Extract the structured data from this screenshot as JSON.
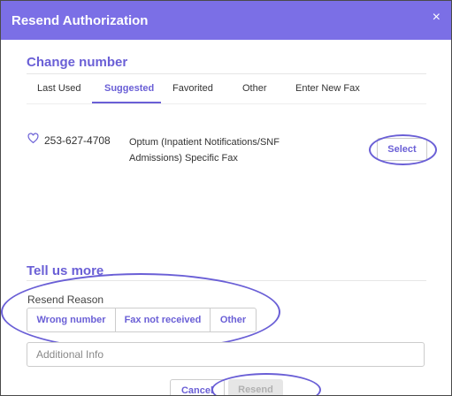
{
  "dialog": {
    "title": "Resend Authorization",
    "close_glyph": "×"
  },
  "change_number": {
    "heading": "Change number",
    "tabs": [
      {
        "label": "Last Used",
        "active": false
      },
      {
        "label": "Suggested",
        "active": true
      },
      {
        "label": "Favorited",
        "active": false
      },
      {
        "label": "Other",
        "active": false
      },
      {
        "label": "Enter New Fax",
        "active": false
      }
    ],
    "fax_entry": {
      "icon": "heart-icon",
      "phone": "253-627-4708",
      "name": "Optum (Inpatient Notifications/SNF Admissions) Specific Fax",
      "select_label": "Select"
    }
  },
  "tell_us_more": {
    "heading": "Tell us more",
    "reason_label": "Resend Reason",
    "reasons": [
      "Wrong number",
      "Fax not received",
      "Other"
    ],
    "additional_info_placeholder": "Additional Info"
  },
  "footer": {
    "cancel_label": "Cancel",
    "resend_label": "Resend"
  },
  "colors": {
    "accent": "#7b6fe6",
    "accent_text": "#6a5fd6",
    "disabled_bg": "#e6e6e6"
  }
}
